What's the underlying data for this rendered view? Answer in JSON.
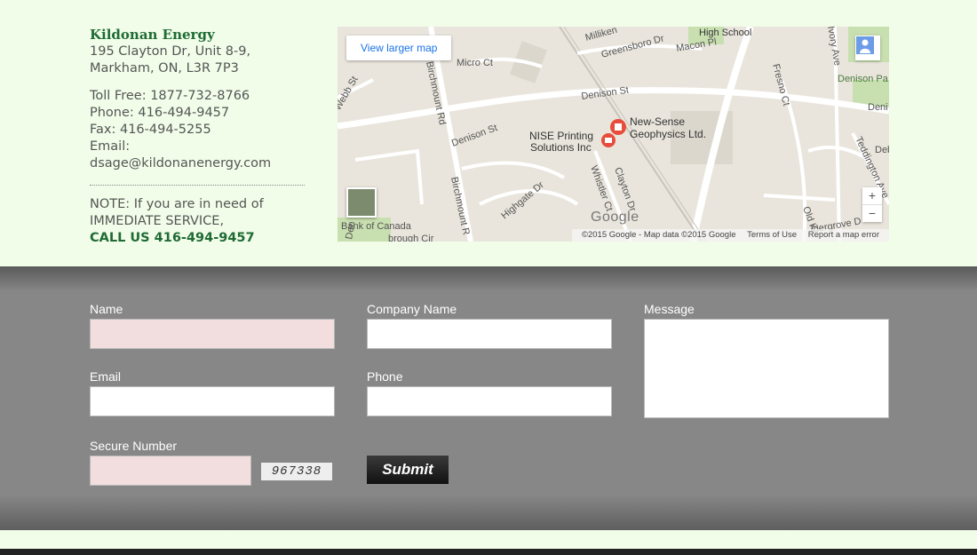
{
  "contact": {
    "company": "Kildonan Energy",
    "address_line1": "195 Clayton Dr, Unit 8-9,",
    "address_line2": "Markham, ON, L3R 7P3",
    "toll_free": "Toll Free: 1877-732-8766",
    "phone": "Phone: 416-494-9457",
    "fax": "Fax: 416-494-5255",
    "email": "Email: dsage@kildonanenergy.com",
    "note_line1": "NOTE: If you are in need of",
    "note_line2": "IMMEDIATE SERVICE,",
    "call_us": "CALL US 416-494-9457"
  },
  "map": {
    "view_larger": "View larger map",
    "labels": {
      "high_school": "High School",
      "milliken": "Milliken",
      "greensboro": "Greensboro Dr",
      "macon": "Macon Pl",
      "micro": "Micro Ct",
      "denison_st": "Denison St",
      "denison_st2": "Denison St",
      "denison_park": "Denison Pa",
      "birchmount": "Birchmount Rd",
      "birchmount2": "Birchmount R",
      "webb": "Webb St",
      "fresno": "Fresno Ct",
      "ivory": "Ivory Ave",
      "teddington": "Teddington Ave",
      "nise1": "NISE Printing",
      "nise2": "Solutions Inc",
      "newsense1": "New-Sense",
      "newsense2": "Geophysics Ltd.",
      "bank": "Bank of Canada",
      "highgate": "Highgate Dr",
      "whistler": "Whistler Ct",
      "clayton": "Clayton Dr",
      "old_k": "Old K",
      "aldergrove": "ldergrove D",
      "deni": "Deni",
      "deb": "Deb",
      "den": "Den",
      "brough": "brough Cir"
    },
    "google_logo": "Google",
    "attribution": "©2015 Google - Map data ©2015 Google",
    "terms": "Terms of Use",
    "report": "Report a map error",
    "zoom_in": "+",
    "zoom_out": "−"
  },
  "form": {
    "name_label": "Name",
    "company_label": "Company Name",
    "message_label": "Message",
    "email_label": "Email",
    "phone_label": "Phone",
    "secure_label": "Secure Number",
    "captcha": "967338",
    "submit": "Submit"
  },
  "colors": {
    "page_bg": "#f1fde9",
    "brand_green": "#1f6b34",
    "form_band": "#878787",
    "invalid_field": "#f2dede"
  }
}
